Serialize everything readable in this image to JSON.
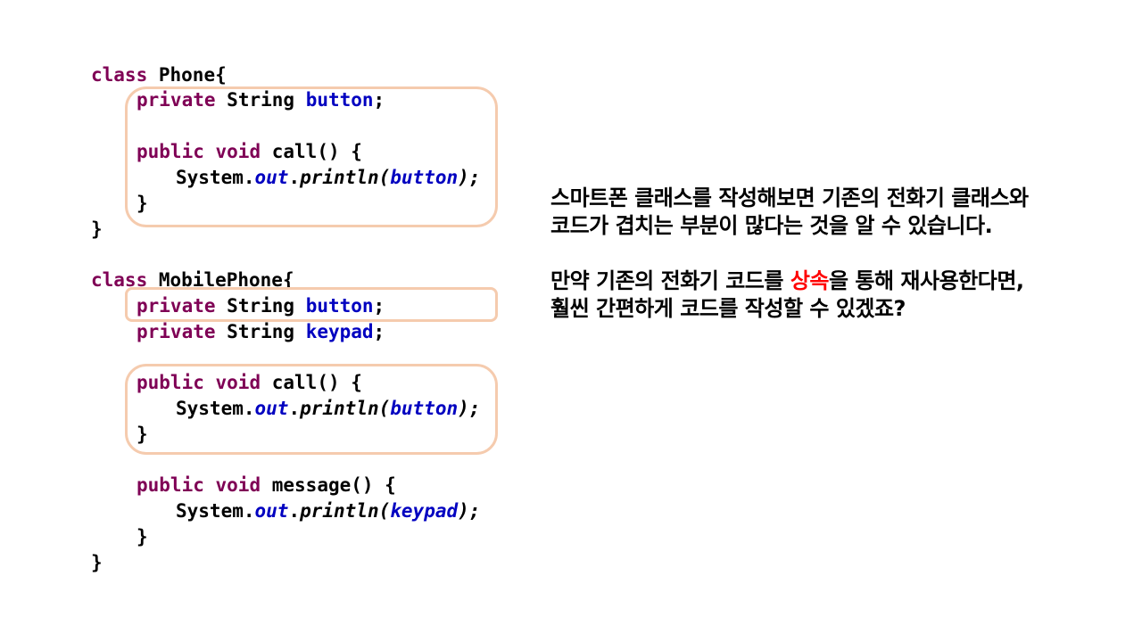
{
  "code": {
    "phone_class": {
      "kw_class": "class",
      "name": "Phone{",
      "field": {
        "kw": "private",
        "type": "String",
        "name": "button",
        "end": ";"
      },
      "method": {
        "kw1": "public",
        "kw2": "void",
        "sig": "call() {"
      },
      "body": {
        "prefix": "System.",
        "out": "out",
        "dot": ".",
        "call": "println(",
        "arg": "button",
        "end": ");"
      },
      "method_close": "}",
      "class_close": "}"
    },
    "mobile_class": {
      "kw_class": "class",
      "name": "MobilePhone{",
      "field1": {
        "kw": "private",
        "type": "String",
        "name": "button",
        "end": ";"
      },
      "field2": {
        "kw": "private",
        "type": "String",
        "name": "keypad",
        "end": ";"
      },
      "method1": {
        "kw1": "public",
        "kw2": "void",
        "sig": "call() {"
      },
      "body1": {
        "prefix": "System.",
        "out": "out",
        "dot": ".",
        "call": "println(",
        "arg": "button",
        "end": ");"
      },
      "method1_close": "}",
      "method2": {
        "kw1": "public",
        "kw2": "void",
        "sig": "message() {"
      },
      "body2": {
        "prefix": "System.",
        "out": "out",
        "dot": ".",
        "call": "println(",
        "arg": "keypad",
        "end": ");"
      },
      "method2_close": "}",
      "class_close": "}"
    }
  },
  "explanation": {
    "para1_line1": "스마트폰 클래스를 작성해보면 기존의 전화기 클래스와",
    "para1_line2": "코드가 겹치는 부분이 많다는 것을 알 수 있습니다.",
    "para2_line1_pre": "만약 기존의 전화기 코드를 ",
    "para2_line1_highlight": "상속",
    "para2_line1_post": "을 통해 재사용한다면,",
    "para2_line2": "훨씬 간편하게 코드를 작성할 수 있겠죠?"
  },
  "colors": {
    "keyword": "#7f0055",
    "field": "#0000c0",
    "highlight_box": "#f5cbae",
    "emphasis": "#ff0000"
  }
}
